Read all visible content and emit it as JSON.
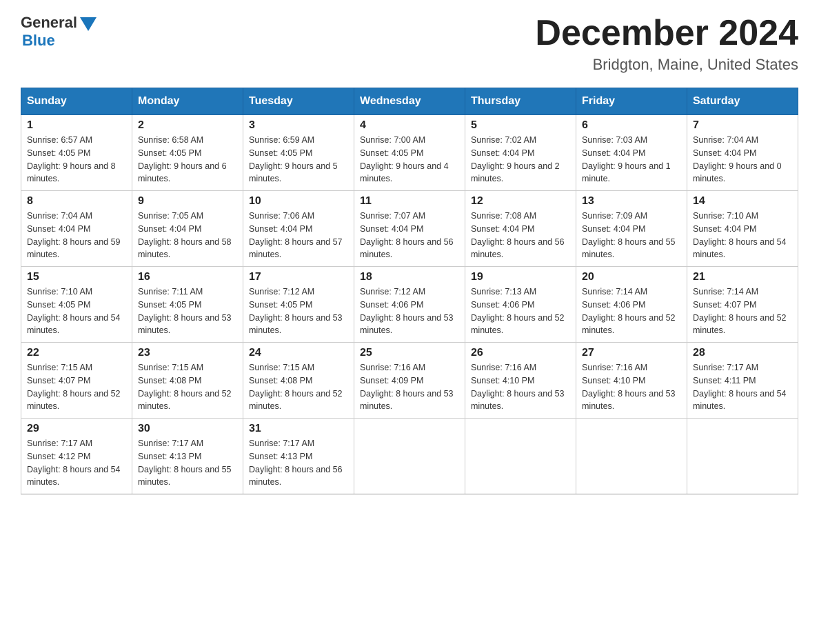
{
  "header": {
    "logo": {
      "general": "General",
      "blue": "Blue"
    },
    "title": "December 2024",
    "location": "Bridgton, Maine, United States"
  },
  "weekdays": [
    "Sunday",
    "Monday",
    "Tuesday",
    "Wednesday",
    "Thursday",
    "Friday",
    "Saturday"
  ],
  "weeks": [
    [
      {
        "day": "1",
        "sunrise": "6:57 AM",
        "sunset": "4:05 PM",
        "daylight": "9 hours and 8 minutes."
      },
      {
        "day": "2",
        "sunrise": "6:58 AM",
        "sunset": "4:05 PM",
        "daylight": "9 hours and 6 minutes."
      },
      {
        "day": "3",
        "sunrise": "6:59 AM",
        "sunset": "4:05 PM",
        "daylight": "9 hours and 5 minutes."
      },
      {
        "day": "4",
        "sunrise": "7:00 AM",
        "sunset": "4:05 PM",
        "daylight": "9 hours and 4 minutes."
      },
      {
        "day": "5",
        "sunrise": "7:02 AM",
        "sunset": "4:04 PM",
        "daylight": "9 hours and 2 minutes."
      },
      {
        "day": "6",
        "sunrise": "7:03 AM",
        "sunset": "4:04 PM",
        "daylight": "9 hours and 1 minute."
      },
      {
        "day": "7",
        "sunrise": "7:04 AM",
        "sunset": "4:04 PM",
        "daylight": "9 hours and 0 minutes."
      }
    ],
    [
      {
        "day": "8",
        "sunrise": "7:04 AM",
        "sunset": "4:04 PM",
        "daylight": "8 hours and 59 minutes."
      },
      {
        "day": "9",
        "sunrise": "7:05 AM",
        "sunset": "4:04 PM",
        "daylight": "8 hours and 58 minutes."
      },
      {
        "day": "10",
        "sunrise": "7:06 AM",
        "sunset": "4:04 PM",
        "daylight": "8 hours and 57 minutes."
      },
      {
        "day": "11",
        "sunrise": "7:07 AM",
        "sunset": "4:04 PM",
        "daylight": "8 hours and 56 minutes."
      },
      {
        "day": "12",
        "sunrise": "7:08 AM",
        "sunset": "4:04 PM",
        "daylight": "8 hours and 56 minutes."
      },
      {
        "day": "13",
        "sunrise": "7:09 AM",
        "sunset": "4:04 PM",
        "daylight": "8 hours and 55 minutes."
      },
      {
        "day": "14",
        "sunrise": "7:10 AM",
        "sunset": "4:04 PM",
        "daylight": "8 hours and 54 minutes."
      }
    ],
    [
      {
        "day": "15",
        "sunrise": "7:10 AM",
        "sunset": "4:05 PM",
        "daylight": "8 hours and 54 minutes."
      },
      {
        "day": "16",
        "sunrise": "7:11 AM",
        "sunset": "4:05 PM",
        "daylight": "8 hours and 53 minutes."
      },
      {
        "day": "17",
        "sunrise": "7:12 AM",
        "sunset": "4:05 PM",
        "daylight": "8 hours and 53 minutes."
      },
      {
        "day": "18",
        "sunrise": "7:12 AM",
        "sunset": "4:06 PM",
        "daylight": "8 hours and 53 minutes."
      },
      {
        "day": "19",
        "sunrise": "7:13 AM",
        "sunset": "4:06 PM",
        "daylight": "8 hours and 52 minutes."
      },
      {
        "day": "20",
        "sunrise": "7:14 AM",
        "sunset": "4:06 PM",
        "daylight": "8 hours and 52 minutes."
      },
      {
        "day": "21",
        "sunrise": "7:14 AM",
        "sunset": "4:07 PM",
        "daylight": "8 hours and 52 minutes."
      }
    ],
    [
      {
        "day": "22",
        "sunrise": "7:15 AM",
        "sunset": "4:07 PM",
        "daylight": "8 hours and 52 minutes."
      },
      {
        "day": "23",
        "sunrise": "7:15 AM",
        "sunset": "4:08 PM",
        "daylight": "8 hours and 52 minutes."
      },
      {
        "day": "24",
        "sunrise": "7:15 AM",
        "sunset": "4:08 PM",
        "daylight": "8 hours and 52 minutes."
      },
      {
        "day": "25",
        "sunrise": "7:16 AM",
        "sunset": "4:09 PM",
        "daylight": "8 hours and 53 minutes."
      },
      {
        "day": "26",
        "sunrise": "7:16 AM",
        "sunset": "4:10 PM",
        "daylight": "8 hours and 53 minutes."
      },
      {
        "day": "27",
        "sunrise": "7:16 AM",
        "sunset": "4:10 PM",
        "daylight": "8 hours and 53 minutes."
      },
      {
        "day": "28",
        "sunrise": "7:17 AM",
        "sunset": "4:11 PM",
        "daylight": "8 hours and 54 minutes."
      }
    ],
    [
      {
        "day": "29",
        "sunrise": "7:17 AM",
        "sunset": "4:12 PM",
        "daylight": "8 hours and 54 minutes."
      },
      {
        "day": "30",
        "sunrise": "7:17 AM",
        "sunset": "4:13 PM",
        "daylight": "8 hours and 55 minutes."
      },
      {
        "day": "31",
        "sunrise": "7:17 AM",
        "sunset": "4:13 PM",
        "daylight": "8 hours and 56 minutes."
      },
      null,
      null,
      null,
      null
    ]
  ]
}
